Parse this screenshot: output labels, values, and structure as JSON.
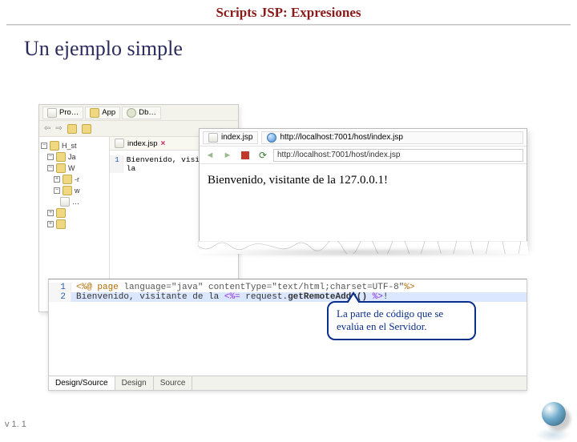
{
  "slide": {
    "title": "Scripts JSP: Expresiones",
    "subtitle": "Un ejemplo simple",
    "version": "v 1. 1"
  },
  "ide": {
    "toolbar": {
      "tab1": "Pro…",
      "tab2": "App",
      "tab3": "Db…"
    },
    "tree": {
      "n1": "H_st",
      "n2": "Ja",
      "n3": "W",
      "n4": "-r",
      "n5": "w",
      "n6": "…"
    },
    "editor": {
      "tab_label": "index.jsp",
      "line_no": "1",
      "line_text": "Bienvenido, visitante de la"
    }
  },
  "browser": {
    "tab_label": "index.jsp",
    "tab_url": "http://localhost:7001/host/index.jsp",
    "addr_url": "http://localhost:7001/host/index.jsp",
    "body_text": "Bienvenido, visitante de la 127.0.0.1!"
  },
  "code": {
    "g1": "1",
    "l1_a": "<%@ page ",
    "l1_b": "language=\"java\" contentType=\"text/html;charset=UTF-8\"",
    "l1_c": "%>",
    "g2": "2",
    "l2_a": "Bienvenido, visitante de la ",
    "l2_b": "<%= ",
    "l2_c": "request.",
    "l2_d": "getRemoteAddr()",
    "l2_e": " %>",
    "l2_f": "!",
    "tabs": {
      "t1": "Design/Source",
      "t2": "Design",
      "t3": "Source"
    }
  },
  "callout": {
    "text": "La parte de código que se evalúa en el Servidor."
  }
}
